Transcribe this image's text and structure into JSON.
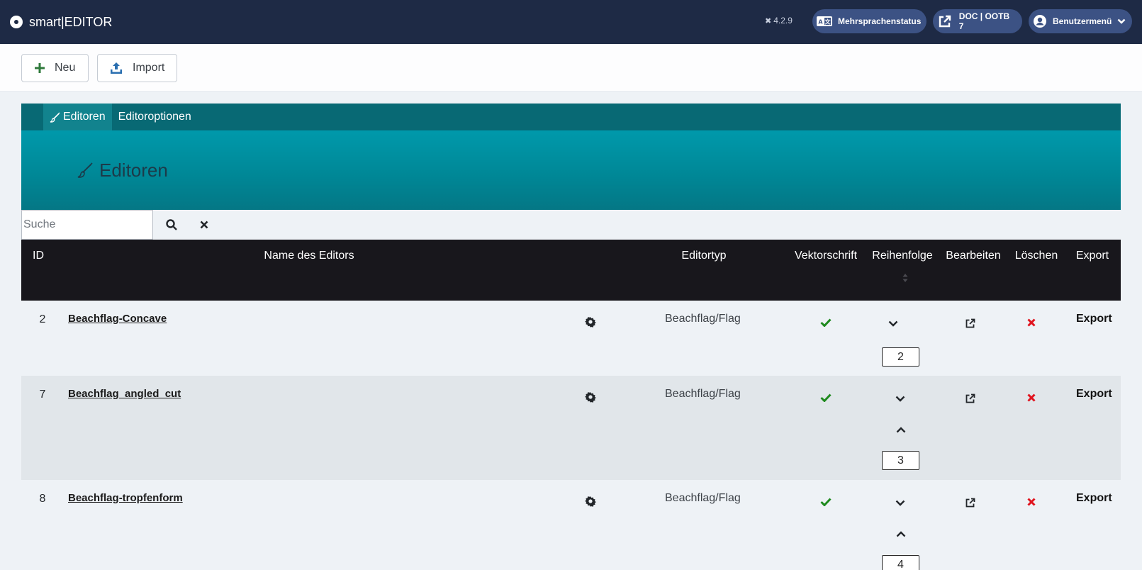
{
  "header": {
    "app_title": "smart|EDITOR",
    "version": "4.2.9",
    "language_status": "Mehrsprachenstatus",
    "doc_link": "DOC | OOTB 7",
    "user_menu": "Benutzermenü"
  },
  "toolbar": {
    "new_label": "Neu",
    "import_label": "Import"
  },
  "subnav": {
    "tabs": [
      {
        "label": "Editoren",
        "active": true
      },
      {
        "label": "Editoroptionen",
        "active": false
      }
    ]
  },
  "banner": {
    "title": "Editoren"
  },
  "search": {
    "placeholder": "Suche",
    "value": ""
  },
  "table": {
    "headers": {
      "id": "ID",
      "name": "Name des Editors",
      "type": "Editortyp",
      "vector": "Vektorschrift",
      "order": "Reihenfolge",
      "edit": "Bearbeiten",
      "delete": "Löschen",
      "export": "Export"
    },
    "rows": [
      {
        "id": "2",
        "name": "Beachflag-Concave",
        "type": "Beachflag/Flag",
        "vector": true,
        "order": "2",
        "export": "Export"
      },
      {
        "id": "7",
        "name": "Beachflag_angled_cut",
        "type": "Beachflag/Flag",
        "vector": true,
        "order": "3",
        "export": "Export"
      },
      {
        "id": "8",
        "name": "Beachflag-tropfenform",
        "type": "Beachflag/Flag",
        "vector": true,
        "order": "4",
        "export": "Export"
      }
    ]
  },
  "colors": {
    "header_bg": "#1e2a45",
    "pill_bg": "#3c5284",
    "teal_nav": "#086974",
    "teal_banner": "#0099ab",
    "table_head": "#18171c",
    "check_green": "#1e8a1e",
    "delete_red": "#e0141e"
  },
  "icons": {
    "logo": "circle-logo-icon",
    "version": "joomla-icon",
    "language": "language-icon",
    "external": "external-link-icon",
    "user": "user-circle-icon",
    "new": "plus-icon",
    "import": "upload-icon",
    "brush": "paintbrush-icon",
    "search": "search-icon",
    "clear": "close-icon",
    "gear": "gear-icon",
    "check": "check-icon",
    "down": "chevron-down-icon",
    "up": "chevron-up-icon",
    "edit": "external-link-icon",
    "delete": "delete-x-icon"
  }
}
